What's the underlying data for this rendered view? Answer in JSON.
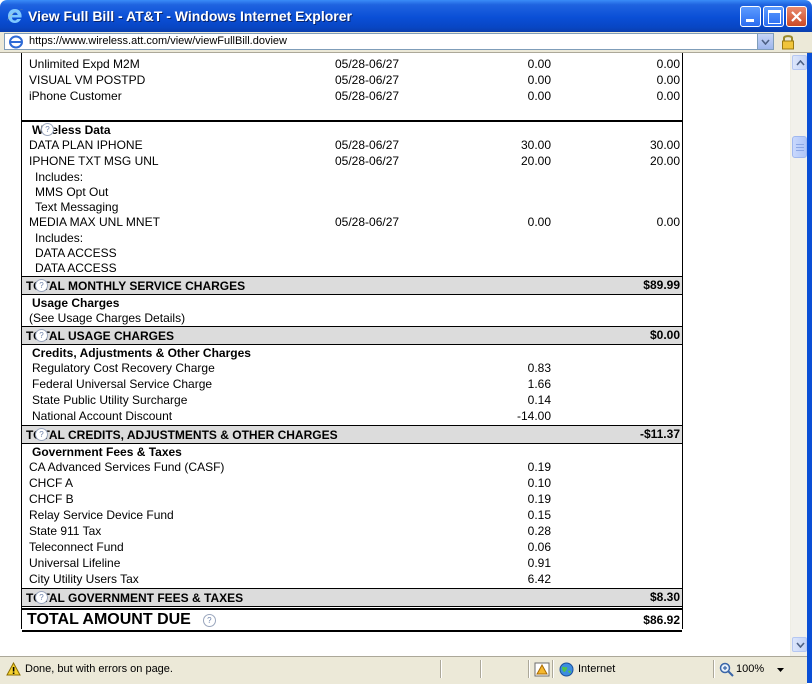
{
  "window": {
    "title": "View Full Bill - AT&T - Windows Internet Explorer"
  },
  "address": {
    "url": "https://www.wireless.att.com/view/viewFullBill.doview"
  },
  "colors": {
    "titlebar": "#0a4fd6",
    "total_row_bg": "#dcdcdc"
  },
  "bill": {
    "plan_rows": [
      {
        "desc": "Unlimited Expd M2M",
        "date": "05/28-06/27",
        "amount": "0.00",
        "total": "0.00"
      },
      {
        "desc": "VISUAL VM POSTPD",
        "date": "05/28-06/27",
        "amount": "0.00",
        "total": "0.00"
      },
      {
        "desc": "iPhone Customer",
        "date": "05/28-06/27",
        "amount": "0.00",
        "total": "0.00"
      }
    ],
    "wireless_data": {
      "heading": "Wireless Data",
      "rows": [
        {
          "desc": "DATA PLAN IPHONE",
          "date": "05/28-06/27",
          "amount": "30.00",
          "total": "30.00"
        },
        {
          "desc": "IPHONE TXT MSG UNL",
          "date": "05/28-06/27",
          "amount": "20.00",
          "total": "20.00"
        }
      ],
      "includes1": [
        "Includes:",
        "MMS Opt Out",
        "Text Messaging"
      ],
      "row3": {
        "desc": "MEDIA MAX UNL MNET",
        "date": "05/28-06/27",
        "amount": "0.00",
        "total": "0.00"
      },
      "includes2": [
        "Includes:",
        "DATA ACCESS",
        "DATA ACCESS"
      ]
    },
    "total_monthly": {
      "label": "TOTAL MONTHLY SERVICE CHARGES",
      "value": "$89.99"
    },
    "usage": {
      "heading": "Usage Charges",
      "note": "(See Usage Charges Details)"
    },
    "total_usage": {
      "label": "TOTAL USAGE CHARGES",
      "value": "$0.00"
    },
    "credits": {
      "heading": "Credits, Adjustments & Other Charges",
      "rows": [
        {
          "desc": "Regulatory Cost Recovery Charge",
          "amount": "0.83"
        },
        {
          "desc": "Federal Universal Service Charge",
          "amount": "1.66"
        },
        {
          "desc": "State Public Utility Surcharge",
          "amount": "0.14"
        },
        {
          "desc": "National Account Discount",
          "amount": "-14.00"
        }
      ]
    },
    "total_credits": {
      "label": "TOTAL CREDITS, ADJUSTMENTS & OTHER CHARGES",
      "value": "-$11.37"
    },
    "gov": {
      "heading": "Government Fees & Taxes",
      "rows": [
        {
          "desc": "CA Advanced Services Fund (CASF)",
          "amount": "0.19"
        },
        {
          "desc": "CHCF A",
          "amount": "0.10"
        },
        {
          "desc": "CHCF B",
          "amount": "0.19"
        },
        {
          "desc": "Relay Service Device Fund",
          "amount": "0.15"
        },
        {
          "desc": "State 911 Tax",
          "amount": "0.28"
        },
        {
          "desc": "Teleconnect Fund",
          "amount": "0.06"
        },
        {
          "desc": "Universal Lifeline",
          "amount": "0.91"
        },
        {
          "desc": "City Utility Users Tax",
          "amount": "6.42"
        }
      ]
    },
    "total_gov": {
      "label": "TOTAL GOVERNMENT FEES & TAXES",
      "value": "$8.30"
    },
    "total_due": {
      "label": "TOTAL AMOUNT DUE",
      "value": "$86.92"
    },
    "help_glyph": "?"
  },
  "status": {
    "message": "Done, but with errors on page.",
    "zone": "Internet",
    "zoom": "100%"
  }
}
